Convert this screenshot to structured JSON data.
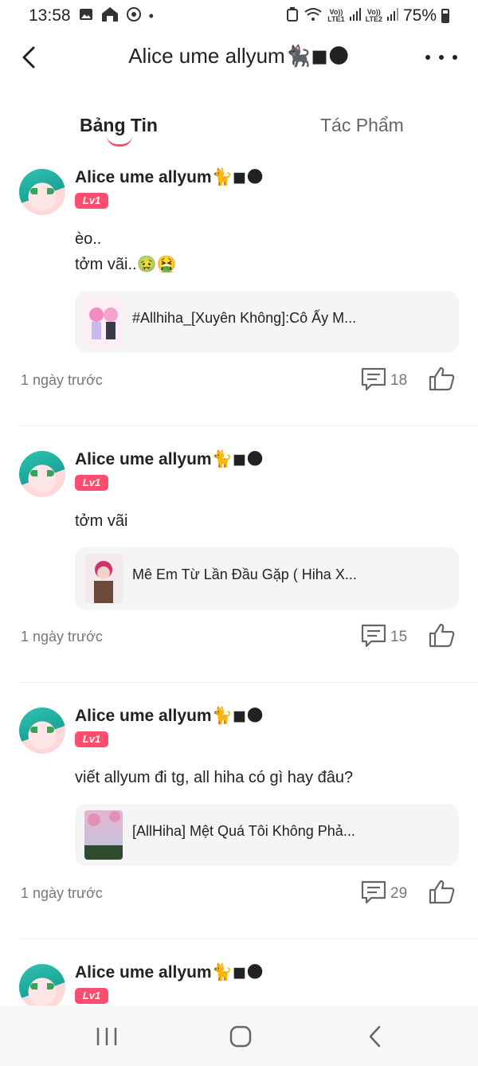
{
  "status_bar": {
    "time": "13:58",
    "battery": "75%",
    "lte1": "LTE1",
    "lte2": "LTE2",
    "volte": "Vo))"
  },
  "header": {
    "title": "Alice ume allyum🐈‍⬛◼🌑"
  },
  "tabs": [
    {
      "label": "Bảng Tin",
      "active": true
    },
    {
      "label": "Tác Phẩm",
      "active": false
    }
  ],
  "posts": [
    {
      "author": "Alice ume allyum🐈◼🌑",
      "level": "Lv1",
      "text_lines": [
        "èo..",
        "tởm vãi..🤢🤮"
      ],
      "card_title": "#Allhiha_[Xuyên Không]:Cô Ấy M...",
      "time": "1 ngày trước",
      "comments": "18"
    },
    {
      "author": "Alice ume allyum🐈◼🌑",
      "level": "Lv1",
      "text_lines": [
        "tởm vãi"
      ],
      "card_title": "Mê Em Từ Lần Đầu Gặp ( Hiha X...",
      "time": "1 ngày trước",
      "comments": "15"
    },
    {
      "author": "Alice ume allyum🐈◼🌑",
      "level": "Lv1",
      "text_lines": [
        "viết allyum đi tg, all hiha có gì hay đâu?"
      ],
      "card_title": "[AllHiha] Mệt Quá Tôi Không Phả...",
      "time": "1 ngày trước",
      "comments": "29"
    },
    {
      "author": "Alice ume allyum🐈◼🌑",
      "level": "Lv1"
    }
  ],
  "colors": {
    "accent": "#ff4d6d",
    "card_bg": "#f5f5f5",
    "muted": "#777777"
  }
}
